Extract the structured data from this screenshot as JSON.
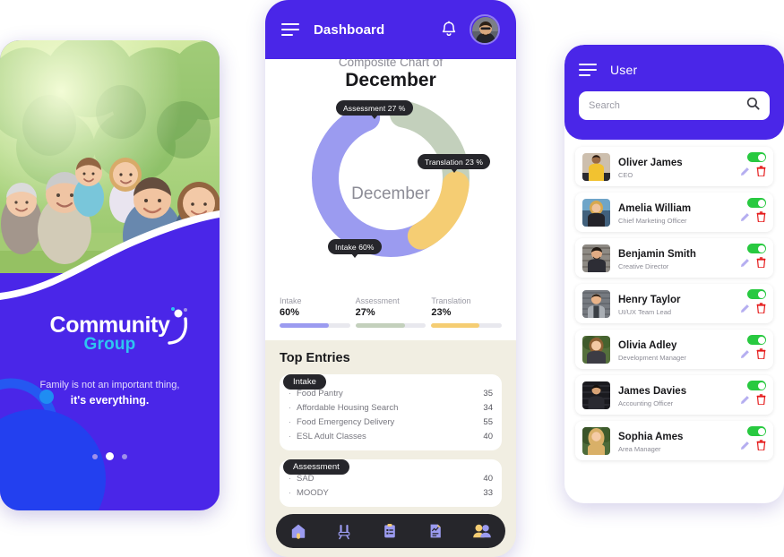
{
  "left_panel": {
    "hero_photo": "family-park-photo",
    "brand_primary": "Community",
    "brand_secondary": "Group",
    "tagline_line1": "Family is not an important thing,",
    "tagline_line2": "it's everything.",
    "pager": {
      "total": 3,
      "active_index": 1
    },
    "colors": {
      "bg": "#4a26e8",
      "accent": "#2ec5f0",
      "deco": "#1e5ff0"
    }
  },
  "dashboard": {
    "header": {
      "menu_icon": "hamburger-icon",
      "title": "Dashboard",
      "bell_icon": "bell-icon",
      "avatar": "user-avatar"
    },
    "chart_title_kicker": "Composite Chart of",
    "chart_title_month": "December",
    "donut_center": "December",
    "tooltips": {
      "assessment": "Assessment  27 %",
      "translation": "Translation  23 %",
      "intake": "Intake  60%"
    },
    "legend": [
      {
        "name": "Intake",
        "value": "60%",
        "percent": 60,
        "bar_fill": 70,
        "color": "#9b9bf0"
      },
      {
        "name": "Assessment",
        "value": "27%",
        "percent": 27,
        "bar_fill": 70,
        "color": "#c3d0bc"
      },
      {
        "name": "Translation",
        "value": "23%",
        "percent": 23,
        "bar_fill": 68,
        "color": "#f5cd73"
      }
    ],
    "entries_title": "Top Entries",
    "groups": [
      {
        "label": "Intake",
        "rows": [
          {
            "name": "Food Pantry",
            "value": "35"
          },
          {
            "name": "Affordable Housing Search",
            "value": "34"
          },
          {
            "name": "Food Emergency Delivery",
            "value": "55"
          },
          {
            "name": "ESL Adult Classes",
            "value": "40"
          }
        ]
      },
      {
        "label": "Assessment",
        "rows": [
          {
            "name": "SAD",
            "value": "40"
          },
          {
            "name": "MOODY",
            "value": "33"
          }
        ]
      }
    ],
    "tabs": [
      {
        "icon": "home-icon",
        "active": true
      },
      {
        "icon": "analytics-chart-icon",
        "active": false
      },
      {
        "icon": "clipboard-list-icon",
        "active": false
      },
      {
        "icon": "document-report-icon",
        "active": false
      },
      {
        "icon": "people-users-icon",
        "active": false
      }
    ]
  },
  "user_panel": {
    "menu_icon": "hamburger-icon",
    "title": "User",
    "search": {
      "value": "",
      "placeholder": "Search",
      "icon": "search-icon"
    },
    "row_actions": {
      "toggle": "status-toggle",
      "edit": "edit-pencil-icon",
      "delete": "delete-trash-icon"
    },
    "users": [
      {
        "name": "Oliver James",
        "role": "CEO",
        "enabled": true,
        "avatar": "photo-oliver"
      },
      {
        "name": "Amelia William",
        "role": "Chief Marketing Officer",
        "enabled": true,
        "avatar": "photo-amelia"
      },
      {
        "name": "Benjamin Smith",
        "role": "Creative Director",
        "enabled": true,
        "avatar": "photo-benjamin"
      },
      {
        "name": "Henry Taylor",
        "role": "UI/UX Team Lead",
        "enabled": true,
        "avatar": "photo-henry"
      },
      {
        "name": "Olivia Adley",
        "role": "Development Manager",
        "enabled": true,
        "avatar": "photo-olivia"
      },
      {
        "name": "James Davies",
        "role": "Accounting Officer",
        "enabled": true,
        "avatar": "photo-james"
      },
      {
        "name": "Sophia Ames",
        "role": "Area Manager",
        "enabled": true,
        "avatar": "photo-sophia"
      }
    ]
  },
  "chart_data": {
    "type": "pie",
    "title": "Composite Chart of December",
    "center_label": "December",
    "labels": [
      "Intake",
      "Assessment",
      "Translation"
    ],
    "values": [
      60,
      27,
      23
    ],
    "value_labels": [
      "60%",
      "27 %",
      "23 %"
    ],
    "colors": [
      "#9b9bf0",
      "#c3d0bc",
      "#f5cd73"
    ],
    "donut": true,
    "legend_position": "bottom",
    "note": "Slice percentages as labelled sum to 110; rendered proportionally by angle."
  }
}
